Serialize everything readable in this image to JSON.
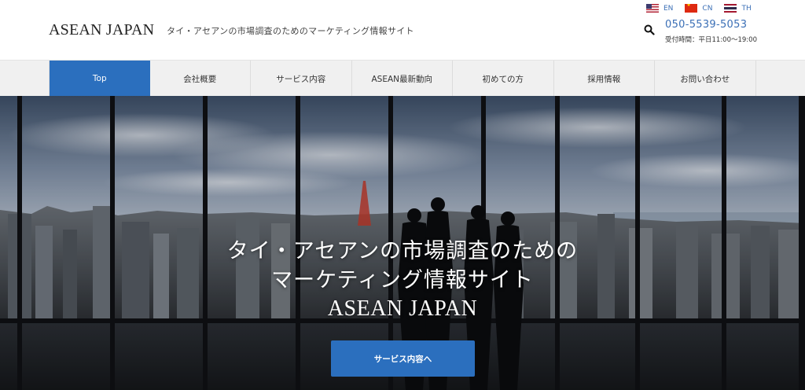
{
  "header": {
    "logo": "ASEAN JAPAN",
    "tagline": "タイ・アセアンの市場調査のためのマーケティング情報サイト",
    "languages": [
      {
        "code": "EN",
        "flag": "us-flag-icon"
      },
      {
        "code": "CN",
        "flag": "china-flag-icon"
      },
      {
        "code": "TH",
        "flag": "thailand-flag-icon"
      }
    ],
    "phone": "050-5539-5053",
    "hours": "受付時間：平日11:00～19:00",
    "search_icon": "search-icon"
  },
  "nav": {
    "items": [
      {
        "label": "Top",
        "active": true
      },
      {
        "label": "会社概要"
      },
      {
        "label": "サービス内容"
      },
      {
        "label": "ASEAN最新動向"
      },
      {
        "label": "初めての方"
      },
      {
        "label": "採用情報"
      },
      {
        "label": "お問い合わせ"
      }
    ]
  },
  "hero": {
    "title_line1": "タイ・アセアンの市場調査のための",
    "title_line2": "マーケティング情報サイト",
    "title_line3": "ASEAN JAPAN",
    "cta_label": "サービス内容へ"
  },
  "colors": {
    "accent": "#2b6fbe",
    "link": "#3b6fb6",
    "nav_bg": "#f0f0f0"
  }
}
